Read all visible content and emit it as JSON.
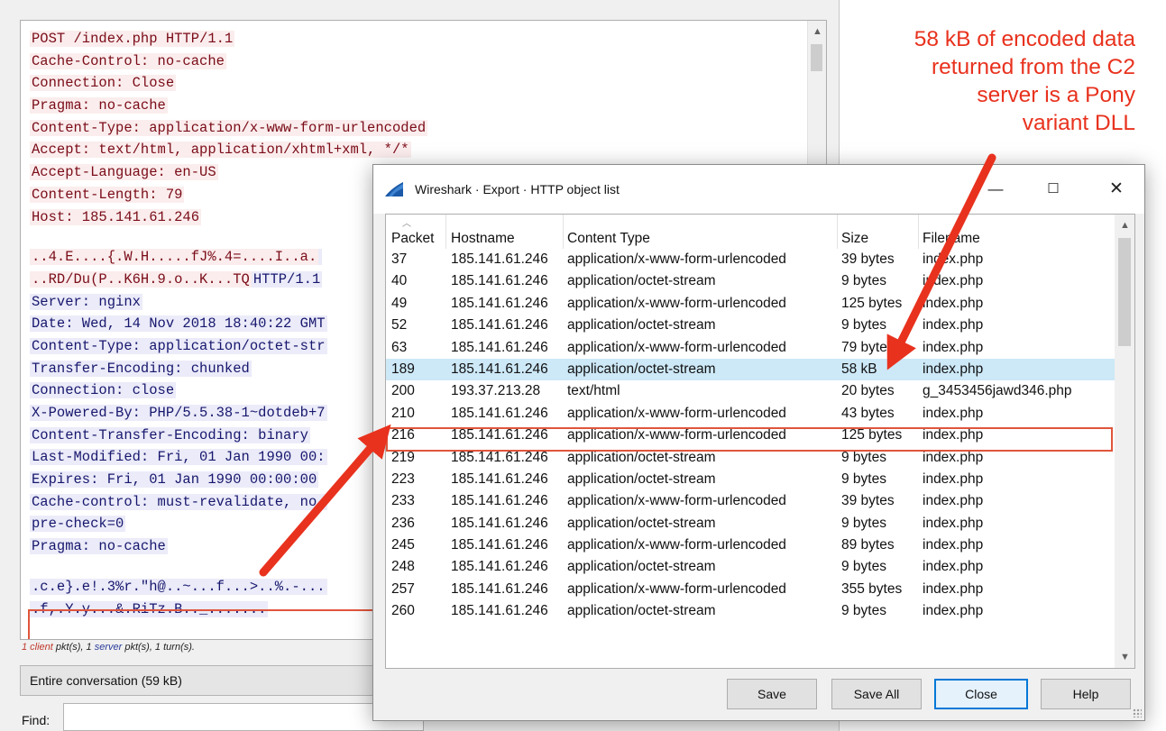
{
  "stream": {
    "client_lines": [
      "POST /index.php HTTP/1.1",
      "Cache-Control: no-cache",
      "Connection: Close",
      "Pragma: no-cache",
      "Content-Type: application/x-www-form-urlencoded",
      "Accept: text/html, application/xhtml+xml, */*",
      "Accept-Language: en-US",
      "Content-Length: 79",
      "Host: 185.141.61.246"
    ],
    "mixed_lines": [
      {
        "client": "..4.E....{.W.H.....fJ%.4=....I..a.",
        "server": ""
      },
      {
        "client": "..RD/Du(P..K6H.9.o..K...TQ",
        "server": "HTTP/1.1"
      }
    ],
    "server_lines": [
      "Server: nginx",
      "Date: Wed, 14 Nov 2018 18:40:22 GMT",
      "Content-Type: application/octet-str",
      "Transfer-Encoding: chunked",
      "Connection: close",
      "X-Powered-By: PHP/5.5.38-1~dotdeb+7",
      "Content-Transfer-Encoding: binary",
      "Last-Modified: Fri, 01 Jan 1990 00:",
      "Expires: Fri, 01 Jan 1990 00:00:00",
      "Cache-control: must-revalidate, no-",
      "pre-check=0",
      "Pragma: no-cache"
    ],
    "data_lines": [
      ".c.e}.e!.3%r.\"h@..~...f...>..%.-...",
      ".f,.Y.y...&.RiTz.B.._......."
    ],
    "turns": {
      "client": "1 client",
      "mid1": " pkt(s), 1 ",
      "server": "server",
      "mid2": " pkt(s), 1 turn(s)."
    },
    "conversation_select": "Entire conversation (59 kB)",
    "find_label": "Find:",
    "find_value": ""
  },
  "annotation": {
    "lines": [
      "58 kB of encoded data",
      "returned from the C2",
      "server is a Pony",
      "variant DLL"
    ],
    "color": "#e8321e"
  },
  "dialog": {
    "title": "Wireshark · Export · HTTP object list",
    "columns": [
      "Packet",
      "Hostname",
      "Content Type",
      "Size",
      "Filename"
    ],
    "rows": [
      {
        "packet": "37",
        "hostname": "185.141.61.246",
        "content_type": "application/x-www-form-urlencoded",
        "size": "39 bytes",
        "filename": "index.php"
      },
      {
        "packet": "40",
        "hostname": "185.141.61.246",
        "content_type": "application/octet-stream",
        "size": "9 bytes",
        "filename": "index.php"
      },
      {
        "packet": "49",
        "hostname": "185.141.61.246",
        "content_type": "application/x-www-form-urlencoded",
        "size": "125 bytes",
        "filename": "index.php"
      },
      {
        "packet": "52",
        "hostname": "185.141.61.246",
        "content_type": "application/octet-stream",
        "size": "9 bytes",
        "filename": "index.php"
      },
      {
        "packet": "63",
        "hostname": "185.141.61.246",
        "content_type": "application/x-www-form-urlencoded",
        "size": "79 bytes",
        "filename": "index.php"
      },
      {
        "packet": "189",
        "hostname": "185.141.61.246",
        "content_type": "application/octet-stream",
        "size": "58 kB",
        "filename": "index.php"
      },
      {
        "packet": "200",
        "hostname": "193.37.213.28",
        "content_type": "text/html",
        "size": "20 bytes",
        "filename": "g_3453456jawd346.php"
      },
      {
        "packet": "210",
        "hostname": "185.141.61.246",
        "content_type": "application/x-www-form-urlencoded",
        "size": "43 bytes",
        "filename": "index.php"
      },
      {
        "packet": "216",
        "hostname": "185.141.61.246",
        "content_type": "application/x-www-form-urlencoded",
        "size": "125 bytes",
        "filename": "index.php"
      },
      {
        "packet": "219",
        "hostname": "185.141.61.246",
        "content_type": "application/octet-stream",
        "size": "9 bytes",
        "filename": "index.php"
      },
      {
        "packet": "223",
        "hostname": "185.141.61.246",
        "content_type": "application/octet-stream",
        "size": "9 bytes",
        "filename": "index.php"
      },
      {
        "packet": "233",
        "hostname": "185.141.61.246",
        "content_type": "application/x-www-form-urlencoded",
        "size": "39 bytes",
        "filename": "index.php"
      },
      {
        "packet": "236",
        "hostname": "185.141.61.246",
        "content_type": "application/octet-stream",
        "size": "9 bytes",
        "filename": "index.php"
      },
      {
        "packet": "245",
        "hostname": "185.141.61.246",
        "content_type": "application/x-www-form-urlencoded",
        "size": "89 bytes",
        "filename": "index.php"
      },
      {
        "packet": "248",
        "hostname": "185.141.61.246",
        "content_type": "application/octet-stream",
        "size": "9 bytes",
        "filename": "index.php"
      },
      {
        "packet": "257",
        "hostname": "185.141.61.246",
        "content_type": "application/x-www-form-urlencoded",
        "size": "355 bytes",
        "filename": "index.php"
      },
      {
        "packet": "260",
        "hostname": "185.141.61.246",
        "content_type": "application/octet-stream",
        "size": "9 bytes",
        "filename": "index.php"
      }
    ],
    "selected_row": 5,
    "buttons": {
      "save": "Save",
      "save_all": "Save All",
      "close": "Close",
      "help": "Help"
    },
    "icons": {
      "app": "wireshark-fin-icon",
      "minimize": "minimize-icon",
      "maximize": "maximize-icon",
      "close": "close-icon"
    }
  },
  "colors": {
    "highlight_box": "#e0553c",
    "client_text": "#7a0c18",
    "server_text": "#17176e",
    "selection": "#cde8f7",
    "app_icon": "#1b5aa8"
  }
}
